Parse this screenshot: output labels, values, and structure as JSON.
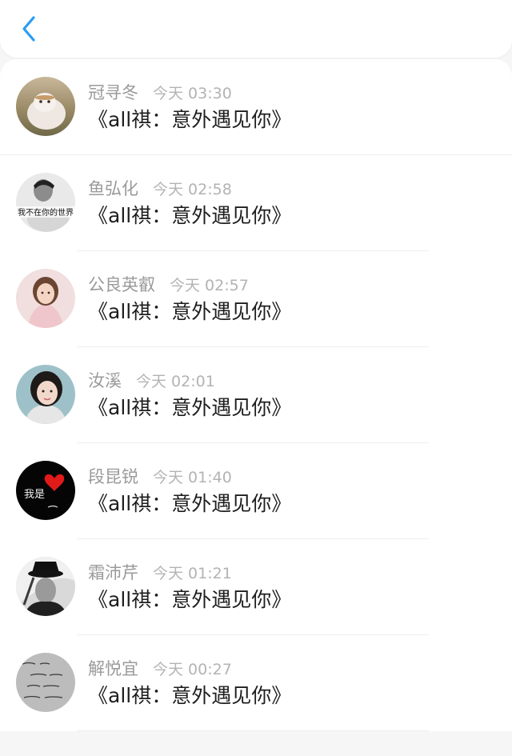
{
  "header": {
    "back_icon": "chevron-left-icon",
    "accent_color": "#2a9df4"
  },
  "items": [
    {
      "name": "冠寻冬",
      "time": "今天 03:30",
      "title": "《all祺：意外遇见你》"
    },
    {
      "name": "鱼弘化",
      "time": "今天 02:58",
      "title": "《all祺：意外遇见你》",
      "avatar_text": "我不在你的世界"
    },
    {
      "name": "公良英叡",
      "time": "今天 02:57",
      "title": "《all祺：意外遇见你》"
    },
    {
      "name": "汝溪",
      "time": "今天 02:01",
      "title": "《all祺：意外遇见你》"
    },
    {
      "name": "段昆锐",
      "time": "今天 01:40",
      "title": "《all祺：意外遇见你》",
      "avatar_text": "我是"
    },
    {
      "name": "霜沛芹",
      "time": "今天 01:21",
      "title": "《all祺：意外遇见你》"
    },
    {
      "name": "解悦宜",
      "time": "今天 00:27",
      "title": "《all祺：意外遇见你》"
    }
  ]
}
